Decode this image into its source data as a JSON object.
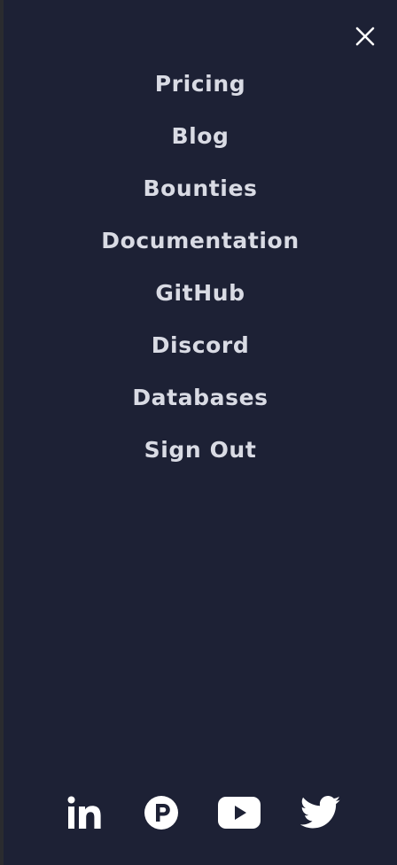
{
  "nav": {
    "items": [
      {
        "label": "Pricing"
      },
      {
        "label": "Blog"
      },
      {
        "label": "Bounties"
      },
      {
        "label": "Documentation"
      },
      {
        "label": "GitHub"
      },
      {
        "label": "Discord"
      },
      {
        "label": "Databases"
      },
      {
        "label": "Sign Out"
      }
    ]
  },
  "social": {
    "icons": [
      "linkedin-icon",
      "producthunt-icon",
      "youtube-icon",
      "twitter-icon"
    ]
  },
  "colors": {
    "panel_background": "#1d2135",
    "text": "#d9dbe4",
    "icon": "#ffffff"
  }
}
